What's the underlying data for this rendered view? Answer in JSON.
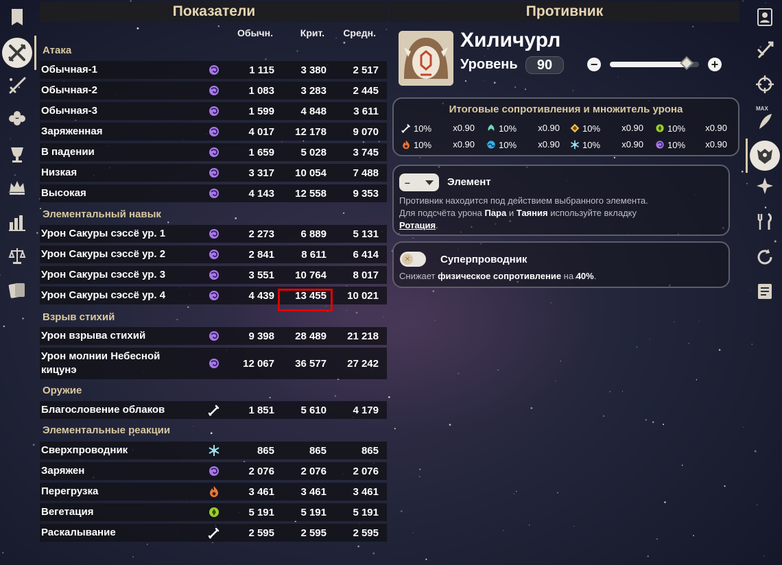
{
  "left_panel": {
    "title": "Показатели",
    "columns": [
      "Обычн.",
      "Крит.",
      "Средн."
    ],
    "sections": [
      {
        "label": "Атака",
        "rows": [
          {
            "name": "Обычная-1",
            "element": "electro",
            "values": [
              "1 115",
              "3 380",
              "2 517"
            ]
          },
          {
            "name": "Обычная-2",
            "element": "electro",
            "values": [
              "1 083",
              "3 283",
              "2 445"
            ]
          },
          {
            "name": "Обычная-3",
            "element": "electro",
            "values": [
              "1 599",
              "4 848",
              "3 611"
            ]
          },
          {
            "name": "Заряженная",
            "element": "electro",
            "values": [
              "4 017",
              "12 178",
              "9 070"
            ]
          },
          {
            "name": "В падении",
            "element": "electro",
            "values": [
              "1 659",
              "5 028",
              "3 745"
            ]
          },
          {
            "name": "Низкая",
            "element": "electro",
            "values": [
              "3 317",
              "10 054",
              "7 488"
            ]
          },
          {
            "name": "Высокая",
            "element": "electro",
            "values": [
              "4 143",
              "12 558",
              "9 353"
            ]
          }
        ]
      },
      {
        "label": "Элементальный навык",
        "rows": [
          {
            "name": "Урон Сакуры сэссё ур. 1",
            "element": "electro",
            "values": [
              "2 273",
              "6 889",
              "5 131"
            ]
          },
          {
            "name": "Урон Сакуры сэссё ур. 2",
            "element": "electro",
            "values": [
              "2 841",
              "8 611",
              "6 414"
            ]
          },
          {
            "name": "Урон Сакуры сэссё ур. 3",
            "element": "electro",
            "values": [
              "3 551",
              "10 764",
              "8 017"
            ]
          },
          {
            "name": "Урон Сакуры сэссё ур. 4",
            "element": "electro",
            "values": [
              "4 439",
              "13 455",
              "10 021"
            ]
          }
        ]
      },
      {
        "label": "Взрыв стихий",
        "rows": [
          {
            "name": "Урон взрыва стихий",
            "element": "electro",
            "values": [
              "9 398",
              "28 489",
              "21 218"
            ]
          },
          {
            "name": "Урон молнии Небесной кицунэ",
            "element": "electro",
            "values": [
              "12 067",
              "36 577",
              "27 242"
            ]
          }
        ]
      },
      {
        "label": "Оружие",
        "rows": [
          {
            "name": "Благословение облаков",
            "element": "physical",
            "values": [
              "1 851",
              "5 610",
              "4 179"
            ]
          }
        ]
      },
      {
        "label": "Элементальные реакции",
        "rows": [
          {
            "name": "Сверхпроводник",
            "element": "cryo",
            "values": [
              "865",
              "865",
              "865"
            ]
          },
          {
            "name": "Заряжен",
            "element": "electro",
            "values": [
              "2 076",
              "2 076",
              "2 076"
            ]
          },
          {
            "name": "Перегрузка",
            "element": "pyro",
            "values": [
              "3 461",
              "3 461",
              "3 461"
            ]
          },
          {
            "name": "Вегетация",
            "element": "dendro",
            "values": [
              "5 191",
              "5 191",
              "5 191"
            ]
          },
          {
            "name": "Раскалывание",
            "element": "physical",
            "values": [
              "2 595",
              "2 595",
              "2 595"
            ]
          }
        ]
      }
    ]
  },
  "right_panel": {
    "title": "Противник",
    "enemy": {
      "name": "Хиличурл",
      "level_label": "Уровень",
      "level": "90",
      "level_fraction": 0.86
    },
    "resistances": {
      "title": "Итоговые сопротивления и множитель урона",
      "items": [
        {
          "element": "physical",
          "res": "10%",
          "mult": "x0.90"
        },
        {
          "element": "anemo",
          "res": "10%",
          "mult": "x0.90"
        },
        {
          "element": "geo",
          "res": "10%",
          "mult": "x0.90"
        },
        {
          "element": "dendro",
          "res": "10%",
          "mult": "x0.90"
        },
        {
          "element": "pyro",
          "res": "10%",
          "mult": "x0.90"
        },
        {
          "element": "hydro",
          "res": "10%",
          "mult": "x0.90"
        },
        {
          "element": "cryo",
          "res": "10%",
          "mult": "x0.90"
        },
        {
          "element": "electro",
          "res": "10%",
          "mult": "x0.90"
        }
      ]
    },
    "element_box": {
      "dropdown_value": "–",
      "label": "Элемент",
      "desc_1": "Противник находится под действием выбранного элемента.",
      "desc_2_a": "Для подсчёта урона ",
      "desc_2_b": "Пара",
      "desc_2_c": " и ",
      "desc_2_d": "Таяния",
      "desc_2_e": " используйте вкладку",
      "desc_3_a": "Ротация",
      "desc_3_b": "."
    },
    "superconduct_box": {
      "label": "Суперпроводник",
      "desc_a": "Снижает ",
      "desc_b": "физическое сопротивление",
      "desc_c": " на ",
      "desc_d": "40%",
      "desc_e": "."
    }
  },
  "sidebar": {
    "max_label": "MAX"
  },
  "colors": {
    "electro": "#a679e6",
    "cryo": "#9fe3ee",
    "pyro": "#e8783a",
    "dendro": "#9ed02a",
    "anemo": "#6fd6bd",
    "hydro": "#2fb2f0",
    "geo": "#f2c04a",
    "physical": "#ffffff",
    "accent_gold": "#d9c8a0",
    "highlight": "#e10000"
  }
}
